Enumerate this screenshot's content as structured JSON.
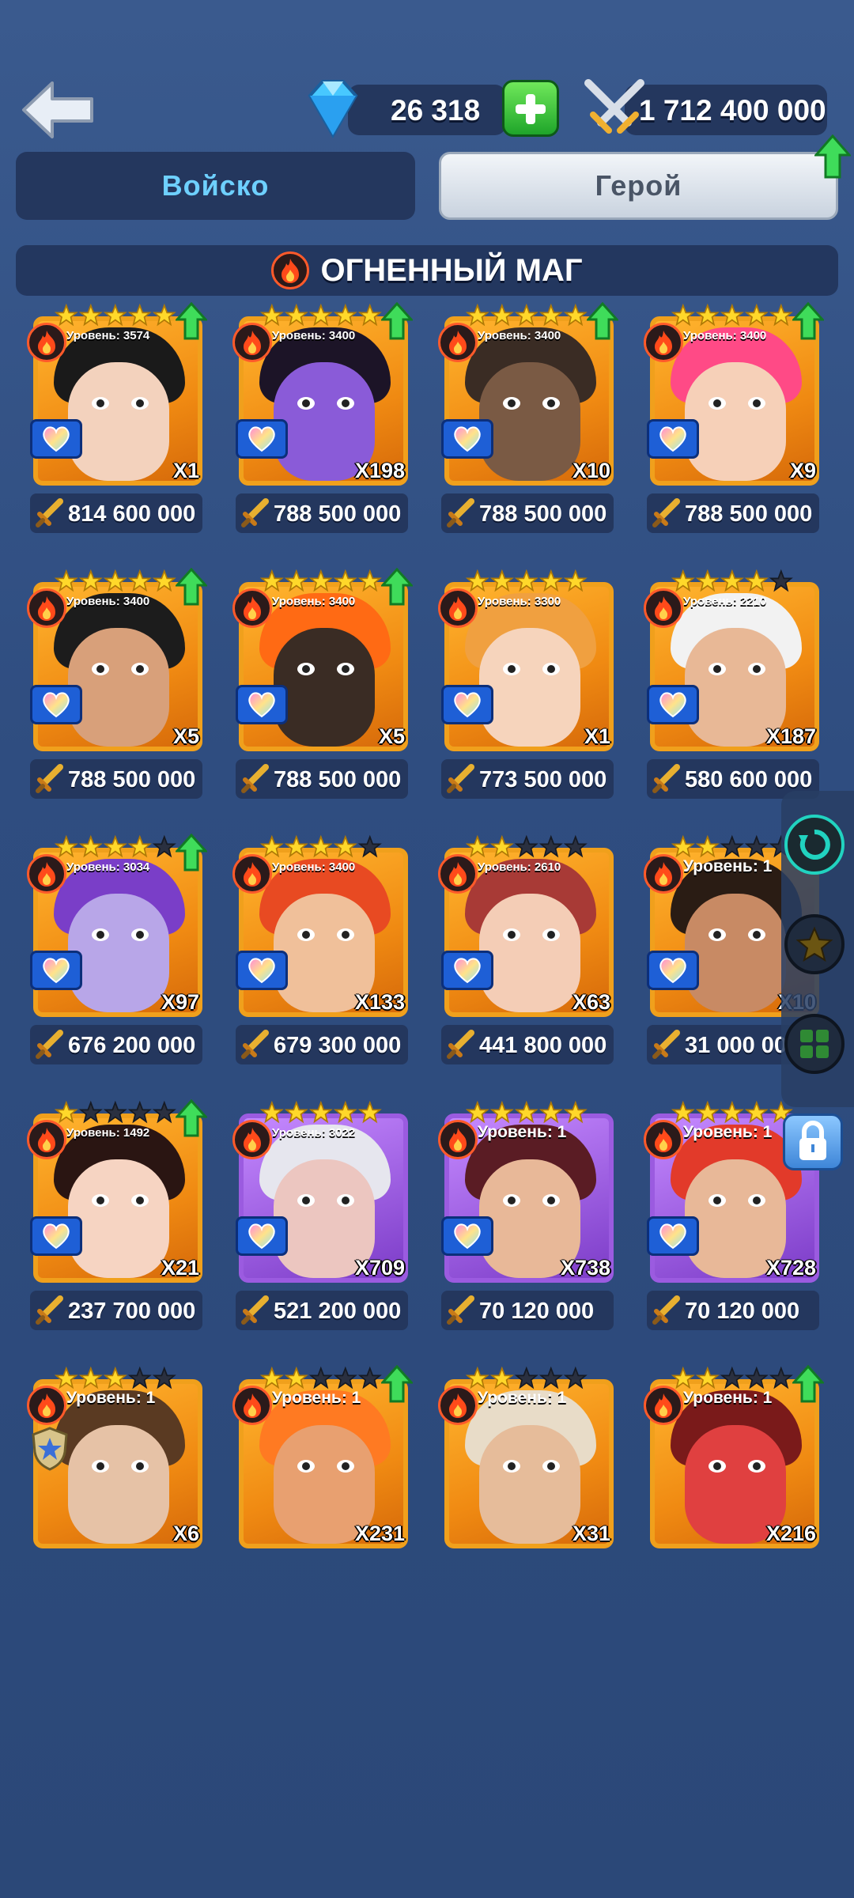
{
  "header": {
    "gems": "26 318",
    "power": "1 712 400 000"
  },
  "tabs": [
    {
      "label": "Войско",
      "active": false
    },
    {
      "label": "Герой",
      "active": true
    }
  ],
  "section": {
    "title": "ОГНЕННЫЙ МАГ"
  },
  "colors": {
    "accent_blue": "#6ed0ff",
    "fire": "#ff5a2a",
    "card_gold": "#f0a01c",
    "card_purple": "#9b5be0",
    "panel": "#24375e"
  },
  "heroes": [
    {
      "level": "Уровень: 3574",
      "count": "X1",
      "power": "814 600 000",
      "stars": 5,
      "upgrade": true,
      "skin": "#f3d2bd",
      "hair": "#1a1a1a",
      "frame": "gold",
      "heart": true
    },
    {
      "level": "Уровень: 3400",
      "count": "X198",
      "power": "788 500 000",
      "stars": 5,
      "upgrade": true,
      "skin": "#8a5bd8",
      "hair": "#1c1427",
      "frame": "gold",
      "heart": true
    },
    {
      "level": "Уровень: 3400",
      "count": "X10",
      "power": "788 500 000",
      "stars": 5,
      "upgrade": true,
      "skin": "#7a5a44",
      "hair": "#3a2c24",
      "frame": "gold",
      "heart": true
    },
    {
      "level": "Уровень: 3400",
      "count": "X9",
      "power": "788 500 000",
      "stars": 5,
      "upgrade": true,
      "skin": "#f6d0b8",
      "hair": "#ff4a86",
      "frame": "gold",
      "heart": true
    },
    {
      "level": "Уровень: 3400",
      "count": "X5",
      "power": "788 500 000",
      "stars": 5,
      "upgrade": true,
      "skin": "#d8a07a",
      "hair": "#1c1c1c",
      "frame": "gold",
      "heart": true
    },
    {
      "level": "Уровень: 3400",
      "count": "X5",
      "power": "788 500 000",
      "stars": 5,
      "upgrade": true,
      "skin": "#3a2c24",
      "hair": "#ff6a14",
      "frame": "gold",
      "heart": true
    },
    {
      "level": "Уровень: 3300",
      "count": "X1",
      "power": "773 500 000",
      "stars": 5,
      "upgrade": false,
      "skin": "#f6d4bc",
      "hair": "#f0a040",
      "frame": "gold",
      "heart": true
    },
    {
      "level": "Уровень: 2210",
      "count": "X187",
      "power": "580 600 000",
      "stars": 4,
      "upgrade": false,
      "skin": "#e8b896",
      "hair": "#f2f2f2",
      "frame": "gold",
      "heart": true
    },
    {
      "level": "Уровень: 3034",
      "count": "X97",
      "power": "676 200 000",
      "stars": 4,
      "upgrade": true,
      "skin": "#b8a6e8",
      "hair": "#7a3ec8",
      "frame": "gold",
      "heart": true
    },
    {
      "level": "Уровень: 3400",
      "count": "X133",
      "power": "679 300 000",
      "stars": 4,
      "upgrade": false,
      "skin": "#f0c09a",
      "hair": "#e84a22",
      "frame": "gold",
      "heart": true
    },
    {
      "level": "Уровень: 2610",
      "count": "X63",
      "power": "441 800 000",
      "stars": 2,
      "upgrade": false,
      "skin": "#f4cdb6",
      "hair": "#a83a36",
      "frame": "gold",
      "heart": true
    },
    {
      "level": "Уровень: 1",
      "count": "X10",
      "power": "31 000 000",
      "stars": 2,
      "upgrade": false,
      "skin": "#c88a64",
      "hair": "#2a1c14",
      "frame": "gold",
      "heart": true
    },
    {
      "level": "Уровень: 1492",
      "count": "X21",
      "power": "237 700 000",
      "stars": 1,
      "upgrade": true,
      "skin": "#f6d4c2",
      "hair": "#2a1512",
      "frame": "gold",
      "heart": true
    },
    {
      "level": "Уровень: 3022",
      "count": "X709",
      "power": "521 200 000",
      "stars": 5,
      "upgrade": false,
      "skin": "#ecc6c0",
      "hair": "#e6e6ee",
      "frame": "purple",
      "heart": true
    },
    {
      "level": "Уровень: 1",
      "count": "X738",
      "power": "70 120 000",
      "stars": 5,
      "upgrade": false,
      "skin": "#e8b898",
      "hair": "#5a1c24",
      "frame": "purple",
      "heart": true
    },
    {
      "level": "Уровень: 1",
      "count": "X728",
      "power": "70 120 000",
      "stars": 5,
      "upgrade": false,
      "skin": "#e8b898",
      "hair": "#e23a2a",
      "frame": "purple",
      "heart": true
    },
    {
      "level": "Уровень: 1",
      "count": "X6",
      "power": "",
      "stars": 3,
      "upgrade": false,
      "skin": "#e6c2a6",
      "hair": "#5a3a22",
      "frame": "gold",
      "heart": false
    },
    {
      "level": "Уровень: 1",
      "count": "X231",
      "power": "",
      "stars": 2,
      "upgrade": true,
      "skin": "#e8a070",
      "hair": "#ff7a22",
      "frame": "gold",
      "heart": false
    },
    {
      "level": "Уровень: 1",
      "count": "X31",
      "power": "",
      "stars": 2,
      "upgrade": false,
      "skin": "#e6bc9a",
      "hair": "#e8dcc8",
      "frame": "gold",
      "heart": false
    },
    {
      "level": "Уровень: 1",
      "count": "X216",
      "power": "",
      "stars": 2,
      "upgrade": true,
      "skin": "#e04040",
      "hair": "#7a1a1a",
      "frame": "gold",
      "heart": false
    }
  ]
}
